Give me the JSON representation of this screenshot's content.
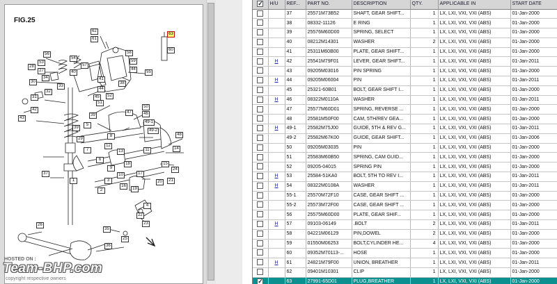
{
  "viewer": {
    "figure_title": "FIG.25",
    "callouts": [
      "62",
      "61",
      "63",
      "60",
      "58",
      "59",
      "56",
      "54",
      "55",
      "57",
      "53",
      "28",
      "27",
      "40",
      "44",
      "41",
      "38",
      "34",
      "30",
      "33",
      "44",
      "52",
      "45",
      "32",
      "31",
      "43",
      "51",
      "50",
      "42",
      "47",
      "46",
      "49-1",
      "39",
      "39",
      "5",
      "49-2",
      "48",
      "8",
      "12",
      "29",
      "14",
      "7",
      "13",
      "11",
      "6",
      "18",
      "9",
      "15",
      "24",
      "17",
      "10",
      "20",
      "21",
      "19",
      "3",
      "2",
      "16",
      "37",
      "1",
      "4",
      "22",
      "23",
      "25",
      "26",
      "35",
      "36"
    ]
  },
  "watermark": {
    "top": "HOSTED ON :",
    "logo": "Team-BHP.com",
    "bottom": "copyright respective owners"
  },
  "grid": {
    "headers": {
      "hu": "H/U",
      "ref": "REF...",
      "part": "PART NO.",
      "desc": "DESCRIPTION",
      "qty": "QTY.",
      "applicable": "APPLICABLE IN",
      "start": "START DATE"
    },
    "rows": [
      {
        "hu": "",
        "ref": "37",
        "part": "25571M73B52",
        "desc": "SHAFT, GEAR SHIFT...",
        "qty": "1",
        "applicable": "LX, LXI, VXI, VXI (ABS)",
        "start": "01-Jan-2000"
      },
      {
        "hu": "",
        "ref": "38",
        "part": "08332-11126",
        "desc": "E RING",
        "qty": "1",
        "applicable": "LX, LXI, VXI, VXI (ABS)",
        "start": "01-Jan-2000"
      },
      {
        "hu": "",
        "ref": "39",
        "part": "25576M60D00",
        "desc": "SPRING, SELECT",
        "qty": "1",
        "applicable": "LX, LXI, VXI, VXI (ABS)",
        "start": "01-Jan-2000"
      },
      {
        "hu": "",
        "ref": "40",
        "part": "08212M14301",
        "desc": "WASHER",
        "qty": "2",
        "applicable": "LX, LXI, VXI, VXI (ABS)",
        "start": "01-Jan-2000"
      },
      {
        "hu": "",
        "ref": "41",
        "part": "25311M60B00",
        "desc": "PLATE, GEAR SHIFT...",
        "qty": "1",
        "applicable": "LX, LXI, VXI, VXI (ABS)",
        "start": "01-Jan-2000"
      },
      {
        "hu": "H",
        "ref": "42",
        "part": "25541M79F01",
        "desc": "LEVER, GEAR SHIFT...",
        "qty": "1",
        "applicable": "LX, LXI, VXI, VXI (ABS)",
        "start": "01-Jan-2011"
      },
      {
        "hu": "",
        "ref": "43",
        "part": "09205M03016",
        "desc": "PIN SPRING",
        "qty": "1",
        "applicable": "LX, LXI, VXI, VXI (ABS)",
        "start": "01-Jan-2000"
      },
      {
        "hu": "H",
        "ref": "44",
        "part": "09205M06004",
        "desc": "PIN",
        "qty": "1",
        "applicable": "LX, LXI, VXI, VXI (ABS)",
        "start": "01-Jan-2011"
      },
      {
        "hu": "",
        "ref": "45",
        "part": "25321-60B01",
        "desc": "BOLT, GEAR SHIFT I...",
        "qty": "1",
        "applicable": "LX, LXI, VXI, VXI (ABS)",
        "start": "01-Jan-2000"
      },
      {
        "hu": "H",
        "ref": "46",
        "part": "08322M0110A",
        "desc": "WASHER",
        "qty": "1",
        "applicable": "LX, LXI, VXI, VXI (ABS)",
        "start": "01-Jan-2011"
      },
      {
        "hu": "",
        "ref": "47",
        "part": "25577M60D01",
        "desc": "SPRING, REVERSE ...",
        "qty": "1",
        "applicable": "LX, LXI, VXI, VXI (ABS)",
        "start": "01-Jan-2000"
      },
      {
        "hu": "",
        "ref": "48",
        "part": "25581M50F00",
        "desc": "CAM, 5TH/REV GEA...",
        "qty": "1",
        "applicable": "LX, LXI, VXI, VXI (ABS)",
        "start": "01-Jan-2000"
      },
      {
        "hu": "H",
        "ref": "49-1",
        "part": "25582M75J00",
        "desc": "GUIDE, 5TH & REV G...",
        "qty": "1",
        "applicable": "LX, LXI, VXI, VXI (ABS)",
        "start": "01-Jan-2011"
      },
      {
        "hu": "",
        "ref": "49-2",
        "part": "25582M67K00",
        "desc": "GUIDE, GEAR SHIFT...",
        "qty": "1",
        "applicable": "LX, LXI, VXI, VXI (ABS)",
        "start": "01-Jan-2006"
      },
      {
        "hu": "",
        "ref": "50",
        "part": "09205M03035",
        "desc": "PIN",
        "qty": "1",
        "applicable": "LX, LXI, VXI, VXI (ABS)",
        "start": "01-Jan-2000"
      },
      {
        "hu": "",
        "ref": "51",
        "part": "25583M60B50",
        "desc": "SPRING, CAM GUID...",
        "qty": "1",
        "applicable": "LX, LXI, VXI, VXI (ABS)",
        "start": "01-Jan-2000"
      },
      {
        "hu": "",
        "ref": "52",
        "part": "09205-04015",
        "desc": "SPRING PIN",
        "qty": "1",
        "applicable": "LX, LXI, VXI, VXI (ABS)",
        "start": "01-Jan-2000"
      },
      {
        "hu": "H",
        "ref": "53",
        "part": "25584-51KA0",
        "desc": "BOLT, 5TH TO REV I...",
        "qty": "1",
        "applicable": "LX, LXI, VXI, VXI (ABS)",
        "start": "01-Jan-2011"
      },
      {
        "hu": "H",
        "ref": "54",
        "part": "08322M0108A",
        "desc": "WASHER",
        "qty": "1",
        "applicable": "LX, LXI, VXI, VXI (ABS)",
        "start": "01-Jan-2011"
      },
      {
        "hu": "",
        "ref": "55-1",
        "part": "25570M72F10",
        "desc": "CASE, GEAR SHIFT ...",
        "qty": "1",
        "applicable": "LX, LXI, VXI, VXI (ABS)",
        "start": "01-Jan-2000"
      },
      {
        "hu": "",
        "ref": "55-2",
        "part": "25573M72F00",
        "desc": "CASE, GEAR SHIFT ...",
        "qty": "1",
        "applicable": "LX, LXI, VXI, VXI (ABS)",
        "start": "01-Jan-2000"
      },
      {
        "hu": "",
        "ref": "56",
        "part": "25575M60D00",
        "desc": "PLATE, GEAR SHIF...",
        "qty": "1",
        "applicable": "LX, LXI, VXI, VXI (ABS)",
        "start": "01-Jan-2000"
      },
      {
        "hu": "H",
        "ref": "57",
        "part": "09103-06149",
        "desc": ".BOLT",
        "qty": "2",
        "applicable": "LX, LXI, VXI, VXI (ABS)",
        "start": "01-Jan-2011"
      },
      {
        "hu": "",
        "ref": "58",
        "part": "04221M06129",
        "desc": "PIN,DOWEL",
        "qty": "2",
        "applicable": "LX, LXI, VXI, VXI (ABS)",
        "start": "01-Jan-2000"
      },
      {
        "hu": "",
        "ref": "59",
        "part": "01550M06253",
        "desc": "BOLT,CYLINDER HE...",
        "qty": "4",
        "applicable": "LX, LXI, VXI, VXI (ABS)",
        "start": "01-Jan-2000"
      },
      {
        "hu": "",
        "ref": "60",
        "part": "09352M70113-...",
        "desc": "HOSE",
        "qty": "1",
        "applicable": "LX, LXI, VXI, VXI (ABS)",
        "start": "01-Jan-2000"
      },
      {
        "hu": "H",
        "ref": "61",
        "part": "24821M79F00",
        "desc": "UNION, BREATHER",
        "qty": "1",
        "applicable": "LX, LXI, VXI, VXI (ABS)",
        "start": "01-Jan-2011"
      },
      {
        "hu": "",
        "ref": "62",
        "part": "09401M10301",
        "desc": "CLIP",
        "qty": "1",
        "applicable": "LX, LXI, VXI, VXI (ABS)",
        "start": "01-Jan-2000"
      },
      {
        "hu": "",
        "ref": "63",
        "part": "27991-65D01",
        "desc": "PLUG,BREATHER",
        "qty": "1",
        "applicable": "LX, LXI, VXI, VXI (ABS)",
        "start": "01-Jan-2000",
        "selected": true
      }
    ]
  },
  "colors": {
    "selected_row": "#0c8f8f",
    "hu_link": "#1d28b0",
    "highlight_callout": "#ffff66"
  }
}
